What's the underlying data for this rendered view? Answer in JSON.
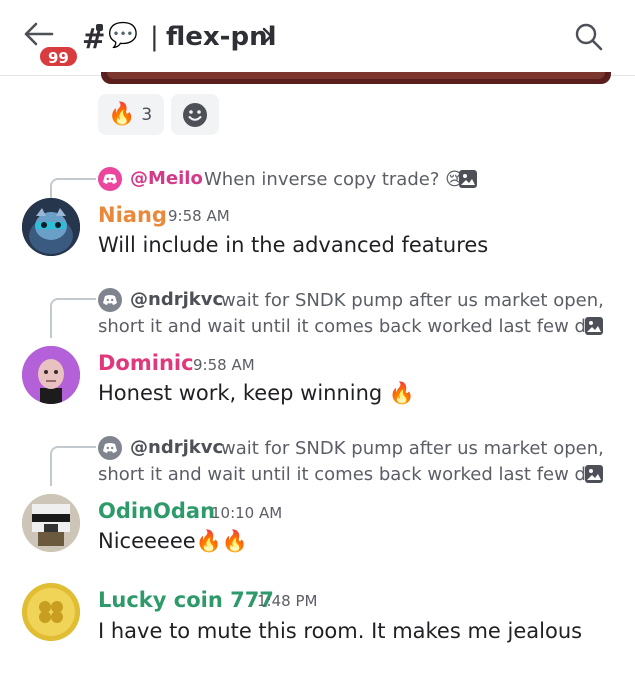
{
  "header": {
    "unread_badge": "99",
    "channel_prefix": "#",
    "thread_emoji": "💬",
    "separator": "|",
    "channel_name": "flex-pnl"
  },
  "reactions": [
    {
      "emoji": "🔥",
      "count": "3"
    }
  ],
  "messages": [
    {
      "reply_to": "@Meilo",
      "reply_text": "When inverse copy trade? 😢",
      "author": "Niang",
      "author_color": "#e8893c",
      "time": "9:58 AM",
      "text": "Will include in the advanced features"
    },
    {
      "reply_to": "@ndrjkvc",
      "reply_text": "wait for SNDK pump after us market open,",
      "reply_text_2": "short it and wait until it comes back worked last few d...",
      "author": "Dominic",
      "author_color": "#e0377d",
      "time": "9:58 AM",
      "text": "Honest work, keep winning 🔥"
    },
    {
      "reply_to": "@ndrjkvc",
      "reply_text": "wait for SNDK pump after us market open,",
      "reply_text_2": "short it and wait until it comes back worked last few d...",
      "author": "OdinOdan",
      "author_color": "#2e9a6a",
      "time": "10:10 AM",
      "text": "Niceeeee🔥🔥"
    },
    {
      "author": "Lucky coin 777",
      "author_color": "#2e9a6a",
      "time": "1:48 PM",
      "text": "I have to mute this room. It makes me jealous"
    }
  ],
  "icons": {
    "back": "arrow-left-icon",
    "search": "search-icon",
    "chevron": "chevron-right-icon",
    "add_reaction": "smiley-icon",
    "image": "image-icon",
    "discord": "discord-icon"
  }
}
